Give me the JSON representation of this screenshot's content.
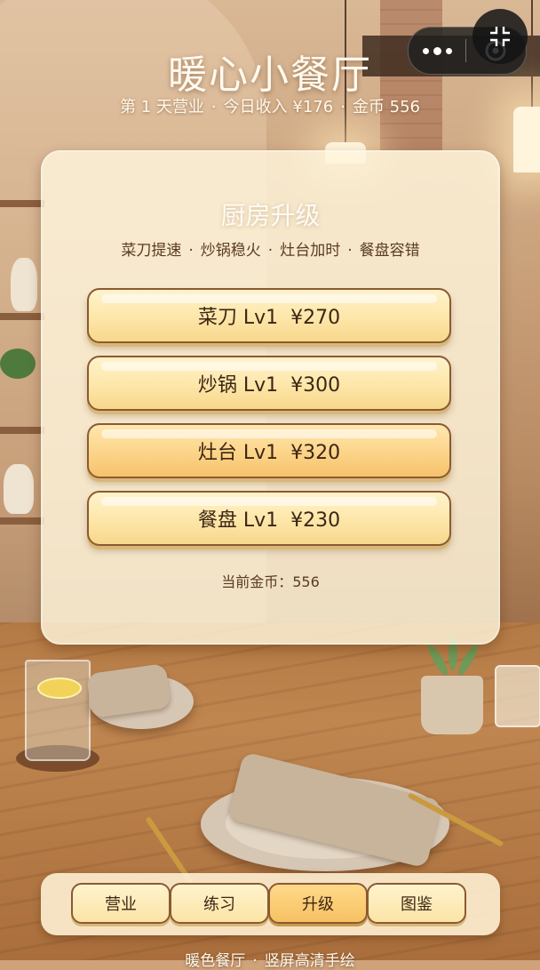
{
  "header": {
    "title": "暖心小餐厅",
    "day_text": "第 1 天营业",
    "income_text": "今日收入 ¥176",
    "coins_text": "金币 556",
    "separator": "·"
  },
  "capsule": {
    "more_icon": "more-dots-icon",
    "close_icon": "target-close-icon",
    "overlay_icon": "fullscreen-corners-icon"
  },
  "panel": {
    "title": "厨房升级",
    "subtitle_items": [
      "菜刀提速",
      "炒锅稳火",
      "灶台加时",
      "餐盘容错"
    ],
    "upgrades": [
      {
        "label": "菜刀 Lv1  ¥270"
      },
      {
        "label": "炒锅 Lv1  ¥300"
      },
      {
        "label": "灶台 Lv1  ¥320"
      },
      {
        "label": "餐盘 Lv1  ¥230"
      }
    ],
    "current_coins": "当前金币：556"
  },
  "nav": {
    "items": [
      {
        "label": "营业",
        "active": false
      },
      {
        "label": "练习",
        "active": false
      },
      {
        "label": "升级",
        "active": true
      },
      {
        "label": "图鉴",
        "active": false
      }
    ]
  },
  "footer": {
    "left": "暖色餐厅",
    "right": "竖屏高清手绘",
    "separator": "·"
  },
  "colors": {
    "button_fill": "#fde6a8",
    "button_border": "#8a5a32",
    "active_tab": "#f6c262",
    "panel_bg": "#fff5dc",
    "text_dark": "#3d2614"
  }
}
